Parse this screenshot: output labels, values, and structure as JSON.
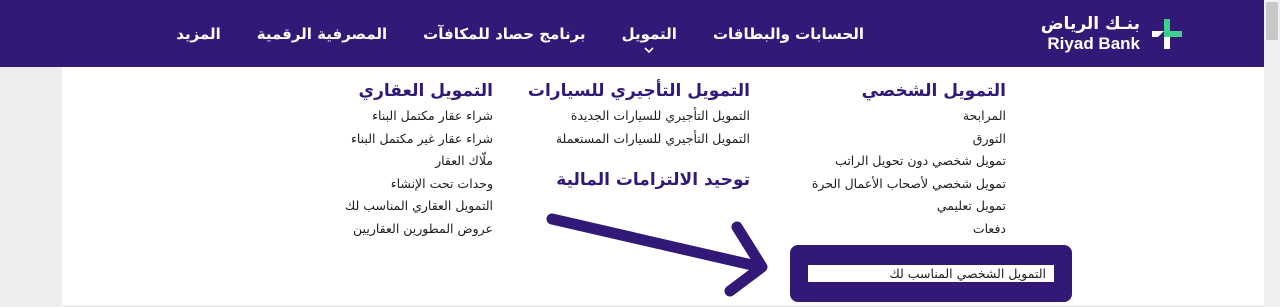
{
  "brand": {
    "name_ar": "بنـك الرياض",
    "name_en": "Riyad Bank",
    "accent": "#321877",
    "logo_green": "#3ccf8e"
  },
  "nav": {
    "items": [
      {
        "label": "الحسابات والبطاقات"
      },
      {
        "label": "التمويل",
        "active": true
      },
      {
        "label": "برنامج حصاد للمكافآت"
      },
      {
        "label": "المصرفية الرقمية"
      },
      {
        "label": "المزيد"
      }
    ]
  },
  "menu": {
    "personal": {
      "title": "التمويل الشخصي",
      "links": [
        "المرابحة",
        "التورق",
        "تمويل شخصي دون تحويل الراتب",
        "تمويل شخصي لأصحاب الأعمال الحرة",
        "تمويل تعليمي",
        "دفعات"
      ],
      "highlighted_link": "التمويل الشخصي المناسب لك"
    },
    "auto": {
      "title": "التمويل التأجيري للسيارات",
      "links": [
        "التمويل التأجيري للسيارات الجديدة",
        "التمويل التأجيري للسيارات المستعملة"
      ],
      "title2": "توحيد الالتزامات المالية"
    },
    "realestate": {
      "title": "التمويل العقاري",
      "links": [
        "شراء عقار مكتمل البناء",
        "شراء عقار غير مكتمل البناء",
        "ملّاك العقار",
        "وحدات تحت الإنشاء",
        "التمويل العقاري المناسب لك",
        "عروض المطورين العقاريين"
      ]
    }
  },
  "icons": {
    "logo": "riyad-bank-logo-icon",
    "caret": "chevron-down-icon",
    "annotation": "arrow-icon"
  }
}
